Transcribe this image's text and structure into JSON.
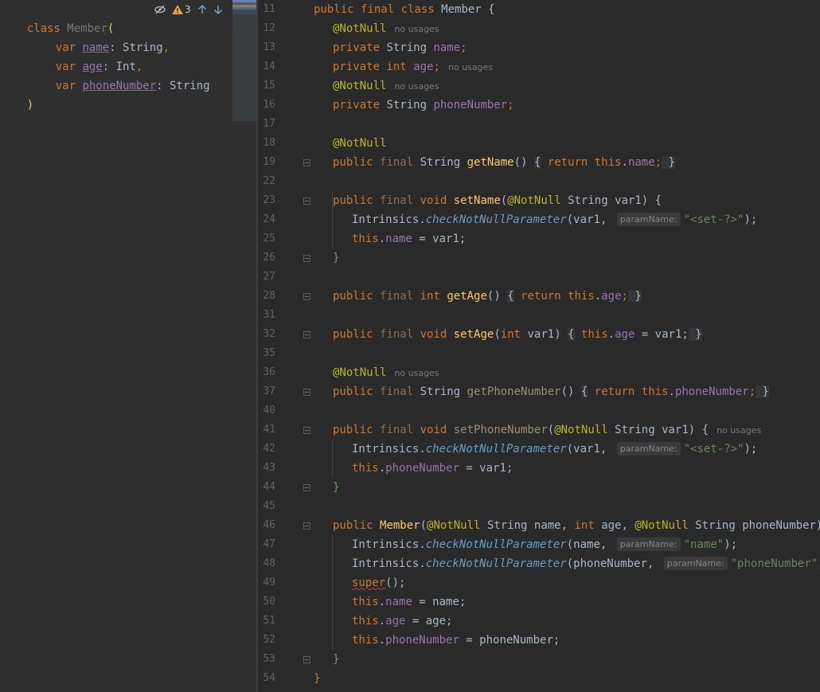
{
  "left_editor": {
    "lines": [
      {
        "prefix": "class ",
        "name": "Member",
        "suffix": "("
      },
      {
        "kw": "var ",
        "prop": "name",
        "type": ": String",
        "tail": ","
      },
      {
        "kw": "var ",
        "prop": "age",
        "type": ": Int",
        "tail": ","
      },
      {
        "kw": "var ",
        "prop": "phoneNumber",
        "type": ": String",
        "tail": ""
      },
      {
        "close": ")"
      }
    ],
    "toolbar": {
      "warnings": "3",
      "icons": [
        "eye-off-icon",
        "warning-icon",
        "arrow-up-icon",
        "arrow-down-icon"
      ]
    }
  },
  "right_editor": {
    "line_numbers": [
      "11",
      "12",
      "13",
      "14",
      "15",
      "16",
      "17",
      "18",
      "19",
      "22",
      "23",
      "24",
      "25",
      "26",
      "27",
      "28",
      "31",
      "32",
      "35",
      "36",
      "37",
      "40",
      "41",
      "42",
      "43",
      "44",
      "45",
      "46",
      "47",
      "48",
      "49",
      "50",
      "51",
      "52",
      "53",
      "54"
    ],
    "no_usages": "no usages",
    "param_hint": "paramName:",
    "code": {
      "l11": {
        "a": "public final class ",
        "b": "Member",
        "c": " {"
      },
      "l12": {
        "ann": "@NotNull"
      },
      "l13": {
        "kw": "private ",
        "type": "String ",
        "fld": "name",
        "end": ";"
      },
      "l14": {
        "kw": "private int ",
        "fld": "age",
        "end": ";"
      },
      "l15": {
        "ann": "@NotNull"
      },
      "l16": {
        "kw": "private ",
        "type": "String ",
        "fld": "phoneNumber",
        "end": ";"
      },
      "l18": {
        "ann": "@NotNull"
      },
      "l19": {
        "kw": "public ",
        "fin": "final ",
        "type": "String ",
        "fn": "getName",
        "p": "() ",
        "ob": "{",
        "ret": " return ",
        "this": "this",
        "dot": ".",
        "fld": "name",
        "semi": ";",
        "cb": " }"
      },
      "l23": {
        "kw": "public ",
        "fin": "final ",
        "vd": "void ",
        "fn": "setName",
        "op": "(",
        "ann": "@NotNull ",
        "type": "String var1",
        "cp": ") {"
      },
      "l24": {
        "cls": "Intrinsics.",
        "m": "checkNotNullParameter",
        "a": "(var1, ",
        "str": "\"<set-?>\"",
        "e": ");"
      },
      "l25": {
        "this": "this",
        "dot": ".",
        "fld": "name",
        "rest": " = var1;"
      },
      "l26": {
        "cb": "}"
      },
      "l28": {
        "kw": "public ",
        "fin": "final ",
        "vd": "int ",
        "fn": "getAge",
        "p": "() ",
        "ob": "{",
        "ret": " return ",
        "this": "this",
        "dot": ".",
        "fld": "age",
        "semi": ";",
        "cb": " }"
      },
      "l32": {
        "kw": "public ",
        "fin": "final ",
        "vd": "void ",
        "fn": "setAge",
        "op": "(",
        "vd2": "int ",
        "var": "var1",
        "cp": ") ",
        "ob": "{",
        "this": " this",
        "dot": ".",
        "fld": "age",
        "rest": " = var1;",
        "cb": " }"
      },
      "l36": {
        "ann": "@NotNull"
      },
      "l37": {
        "kw": "public ",
        "fin": "final ",
        "type": "String ",
        "fn": "getPhoneNumber",
        "p": "() ",
        "ob": "{",
        "ret": " return ",
        "this": "this",
        "dot": ".",
        "fld": "phoneNumber",
        "semi": ";",
        "cb": " }"
      },
      "l41": {
        "kw": "public ",
        "fin": "final ",
        "vd": "void ",
        "fn": "setPhoneNumber",
        "op": "(",
        "ann": "@NotNull ",
        "type": "String var1",
        "cp": ") {"
      },
      "l42": {
        "cls": "Intrinsics.",
        "m": "checkNotNullParameter",
        "a": "(var1, ",
        "str": "\"<set-?>\"",
        "e": ");"
      },
      "l43": {
        "this": "this",
        "dot": ".",
        "fld": "phoneNumber",
        "rest": " = var1;"
      },
      "l44": {
        "cb": "}"
      },
      "l46": {
        "kw": "public ",
        "fn": "Member",
        "op": "(",
        "ann1": "@NotNull ",
        "t1": "String name, ",
        "kw2": "int ",
        "t2": "age, ",
        "ann2": "@NotNull ",
        "t3": "String phoneNumber",
        "cp": ") {"
      },
      "l47": {
        "cls": "Intrinsics.",
        "m": "checkNotNullParameter",
        "a": "(name, ",
        "str": "\"name\"",
        "e": ");"
      },
      "l48": {
        "cls": "Intrinsics.",
        "m": "checkNotNullParameter",
        "a": "(phoneNumber, ",
        "str": "\"phoneNumber\"",
        "e": ");"
      },
      "l49": {
        "s": "super",
        "e": "();"
      },
      "l50": {
        "this": "this",
        "dot": ".",
        "fld": "name",
        "rest": " = name;"
      },
      "l51": {
        "this": "this",
        "dot": ".",
        "fld": "age",
        "rest": " = age;"
      },
      "l52": {
        "this": "this",
        "dot": ".",
        "fld": "phoneNumber",
        "rest": " = phoneNumber;"
      },
      "l53": {
        "cb": "}"
      },
      "l54": {
        "cb": "}"
      }
    }
  },
  "colors": {
    "keyword": "#cc7832",
    "annotation": "#bbb529",
    "string": "#6a8759",
    "field": "#9876aa",
    "function": "#ffc66d",
    "static_method": "#6d9cbe",
    "background": "#2b2b2b"
  }
}
